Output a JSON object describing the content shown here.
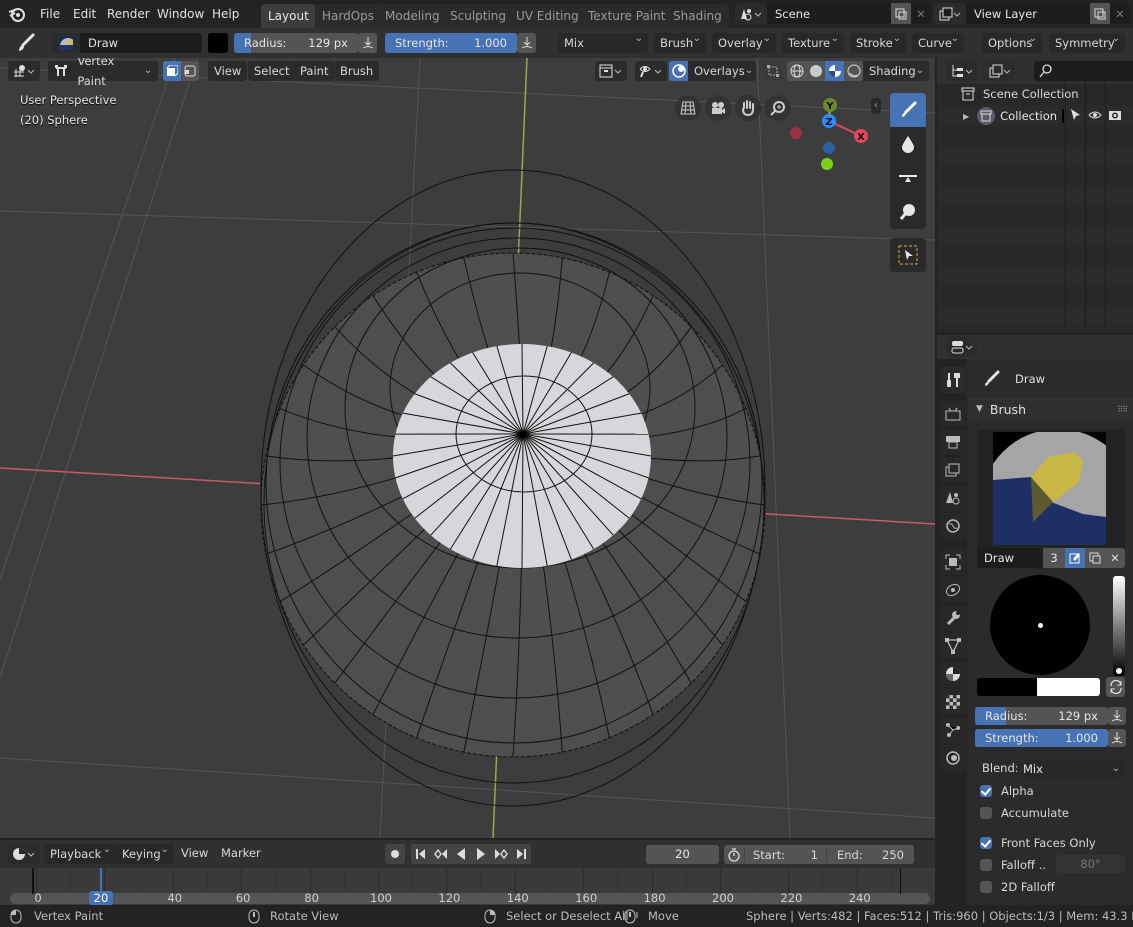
{
  "topbar": {
    "menus": [
      "File",
      "Edit",
      "Render",
      "Window",
      "Help"
    ],
    "workspaces": [
      "Layout",
      "HardOps",
      "Modeling",
      "Sculpting",
      "UV Editing",
      "Texture Paint",
      "Shading"
    ],
    "active_workspace": "Layout",
    "scene": "Scene",
    "view_layer": "View Layer"
  },
  "toolheader": {
    "brush_name": "Draw",
    "radius_label": "Radius:",
    "radius_value": "129 px",
    "radius_fraction": 0.2,
    "strength_label": "Strength:",
    "strength_value": "1.000",
    "strength_fraction": 1.0,
    "blend": "Mix",
    "menus": [
      "Brush",
      "Overlay",
      "Texture",
      "Stroke",
      "Curve"
    ],
    "right_menus": [
      "Options",
      "Symmetry"
    ]
  },
  "viewport": {
    "mode": "Vertex Paint",
    "menus": [
      "View",
      "Select",
      "Paint",
      "Brush"
    ],
    "overlays_label": "Overlays",
    "shading_label": "Shading",
    "info_line1": "User Perspective",
    "info_line2": "(20) Sphere",
    "gizmo": {
      "x": "X",
      "y": "Y",
      "z": "Z"
    },
    "colors": {
      "x_axis": "#e4475e",
      "y_axis": "#8bc34a",
      "z_axis": "#2a8cff",
      "background": "#3d3d3d",
      "accent": "#4772b3"
    }
  },
  "outliner": {
    "root": "Scene Collection",
    "items": [
      {
        "label": "Collection"
      }
    ]
  },
  "properties": {
    "tool_name": "Draw",
    "panel_title": "Brush",
    "brush_datablock": "Draw",
    "brush_users": "3",
    "radius_label": "Radius:",
    "radius_value": "129 px",
    "radius_fraction": 0.2,
    "strength_label": "Strength:",
    "strength_value": "1.000",
    "strength_fraction": 1.0,
    "blend_label": "Blend:",
    "blend_value": "Mix",
    "options": [
      {
        "label": "Alpha",
        "checked": true
      },
      {
        "label": "Accumulate",
        "checked": false
      },
      {
        "label": "Front Faces Only",
        "checked": true
      },
      {
        "label": "Falloff ..",
        "checked": false
      },
      {
        "label": "2D Falloff",
        "checked": false
      }
    ],
    "falloff_angle": "80°"
  },
  "timeline": {
    "menus": [
      "Playback",
      "Keying",
      "View",
      "Marker"
    ],
    "current_frame": "20",
    "start_label": "Start:",
    "start": "1",
    "end_label": "End:",
    "end": "250",
    "ruler": [
      "0",
      "20",
      "40",
      "60",
      "80",
      "100",
      "120",
      "140",
      "160",
      "180",
      "200",
      "220",
      "240"
    ]
  },
  "statusbar": {
    "left_hint": "Vertex Paint",
    "middle_hint": "Rotate View",
    "right_hint": "Select or Deselect All",
    "move_hint": "Move",
    "stats": "Sphere | Verts:482 | Faces:512 | Tris:960 | Objects:1/3 | Mem: 43.3 MB | v2.8"
  }
}
